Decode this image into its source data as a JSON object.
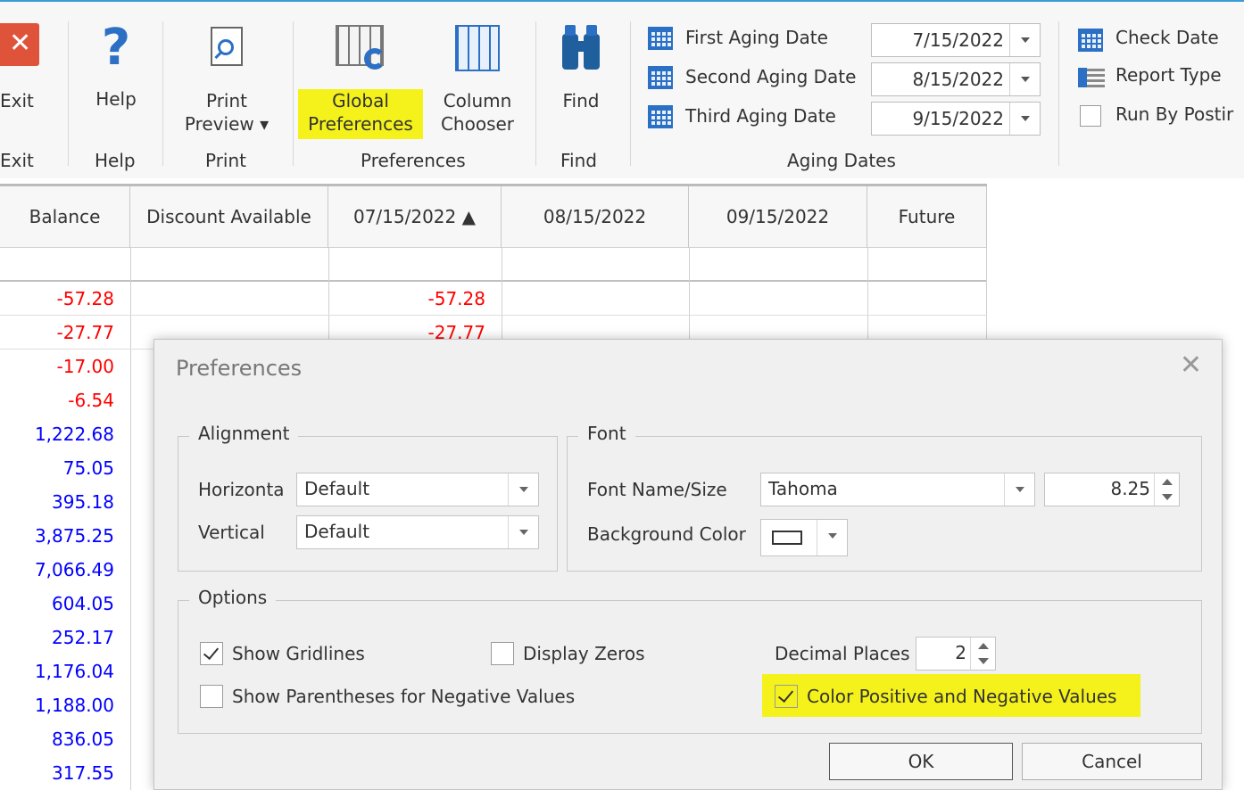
{
  "ribbon": {
    "exit_label": "Exit",
    "help_label": "Help",
    "print_preview_line1": "Print",
    "print_preview_line2": "Preview ▾",
    "global_prefs_line1": "Global",
    "global_prefs_line2": "Preferences",
    "column_chooser_line1": "Column",
    "column_chooser_line2": "Chooser",
    "find_label": "Find",
    "groups": {
      "exit": "Exit",
      "help": "Help",
      "print": "Print",
      "preferences": "Preferences",
      "find": "Find",
      "aging_dates": "Aging Dates"
    },
    "aging": {
      "first_label": "First Aging Date",
      "first_value": "7/15/2022",
      "second_label": "Second Aging Date",
      "second_value": "8/15/2022",
      "third_label": "Third Aging Date",
      "third_value": "9/15/2022"
    },
    "right": {
      "check_date": "Check Date",
      "report_type": "Report Type",
      "run_by_posting": "Run By Postir"
    }
  },
  "grid": {
    "columns": [
      "Balance",
      "Discount Available",
      "07/15/2022 ▲",
      "08/15/2022",
      "09/15/2022",
      "Future"
    ],
    "balance": [
      "-57.28",
      "-27.77",
      "-17.00",
      "-6.54",
      "1,222.68",
      "75.05",
      "395.18",
      "3,875.25",
      "7,066.49",
      "604.05",
      "252.17",
      "1,176.04",
      "1,188.00",
      "836.05",
      "317.55"
    ],
    "col_0715": [
      "-57.28",
      "-27.77"
    ],
    "colors": {
      "negative": "#ff0000",
      "positive": "#0000ff"
    }
  },
  "dialog": {
    "title": "Preferences",
    "close_glyph": "✕",
    "alignment": {
      "title": "Alignment",
      "horizontal_label": "Horizonta",
      "horizontal_value": "Default",
      "vertical_label": "Vertical",
      "vertical_value": "Default"
    },
    "font": {
      "title": "Font",
      "name_size_label": "Font Name/Size",
      "font_name": "Tahoma",
      "font_size": "8.25",
      "background_label": "Background Color"
    },
    "options": {
      "title": "Options",
      "show_gridlines": "Show Gridlines",
      "show_gridlines_checked": true,
      "display_zeros": "Display Zeros",
      "display_zeros_checked": false,
      "decimal_places_label": "Decimal Places",
      "decimal_places": "2",
      "show_parentheses": "Show Parentheses for Negative Values",
      "show_parentheses_checked": false,
      "color_values": "Color Positive and Negative Values",
      "color_values_checked": true
    },
    "ok_label": "OK",
    "cancel_label": "Cancel"
  },
  "highlight_color": "#f4f21a"
}
